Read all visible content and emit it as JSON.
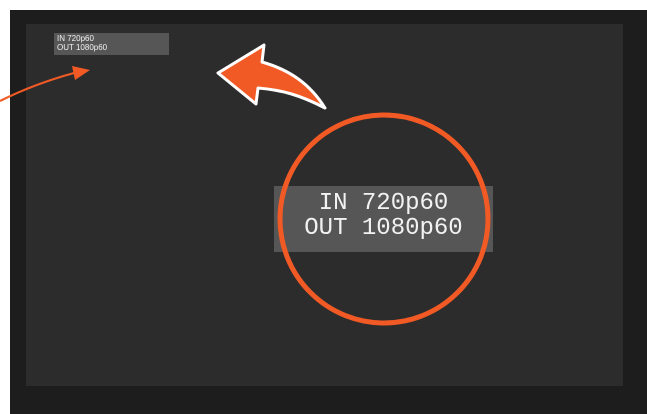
{
  "osd": {
    "line1": "IN 720p60",
    "line2": "OUT 1080p60"
  },
  "colors": {
    "accent": "#f15a24",
    "osd_background": "#575656",
    "screen": "#2d2c2d",
    "bezel": "#1e1d1e"
  },
  "icons": [
    "callout-arrow-icon",
    "curved-arrow-icon",
    "magnifier-circle-icon"
  ]
}
